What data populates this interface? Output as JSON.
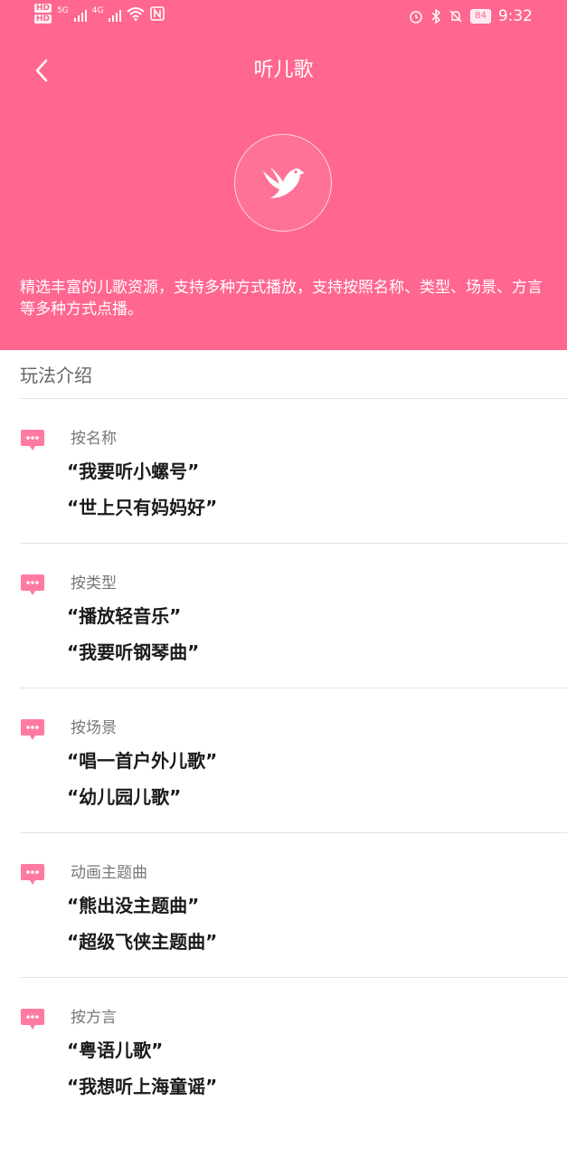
{
  "status_bar": {
    "hd1": "HD",
    "hd2": "HD",
    "net1": "5G",
    "net2": "4G",
    "battery": "84",
    "time": "9:32"
  },
  "header": {
    "title": "听儿歌",
    "description": "精选丰富的儿歌资源，支持多种方式播放，支持按照名称、类型、场景、方言等多种方式点播。"
  },
  "intro": {
    "title": "玩法介绍"
  },
  "sections": [
    {
      "category": "按名称",
      "examples": [
        "“我要听小螺号”",
        "“世上只有妈妈好”"
      ]
    },
    {
      "category": "按类型",
      "examples": [
        "“播放轻音乐”",
        "“我要听钢琴曲”"
      ]
    },
    {
      "category": "按场景",
      "examples": [
        "“唱一首户外儿歌”",
        "“幼儿园儿歌”"
      ]
    },
    {
      "category": "动画主题曲",
      "examples": [
        "“熊出没主题曲”",
        "“超级飞侠主题曲”"
      ]
    },
    {
      "category": "按方言",
      "examples": [
        "“粤语儿歌”",
        "“我想听上海童谣”"
      ]
    }
  ],
  "colors": {
    "primary": "#ff6690",
    "bubble": "#ff7aa2"
  },
  "icons": {
    "back": "chevron-left-icon",
    "logo": "bird-icon",
    "bubble": "chat-bubble-icon"
  }
}
